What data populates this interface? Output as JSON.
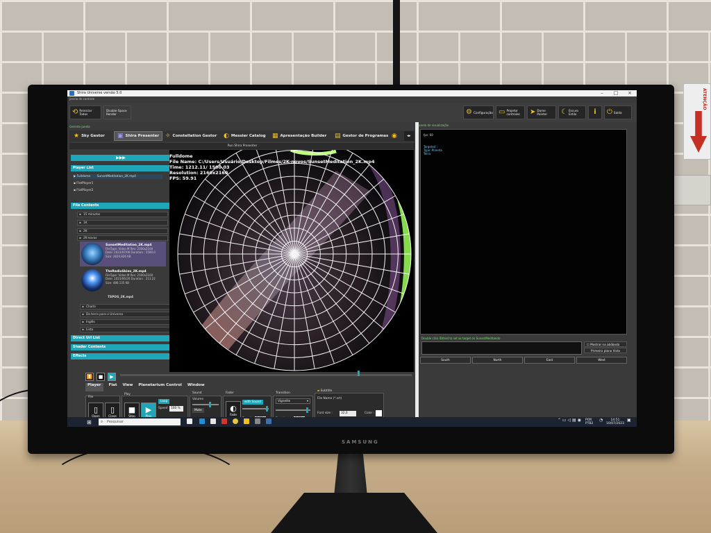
{
  "window": {
    "title": "Shira Universe versão 5.0",
    "control_label": "Janela de controle"
  },
  "toolbar": {
    "reiniciar": "Reiniciar Todos",
    "disable_space": "Disable Space Render",
    "configuracao": "Configuração",
    "projetor": "Projetor controles",
    "dome_pointer": "Dome Pointer",
    "escuro": "Escuro Estilo",
    "info": "i",
    "saida": "Saída"
  },
  "gerente_label": "Gerente Janela",
  "visualizacao_label": "Janela de visualização",
  "tabs": [
    {
      "label": "Sky Gestor"
    },
    {
      "label": "Shira Presenter"
    },
    {
      "label": "Constellation Gestor"
    },
    {
      "label": "Messier Catalog"
    },
    {
      "label": "Apresentação Builder"
    },
    {
      "label": "Gestor de Programas"
    }
  ],
  "run_bar": "Run Shira Presenter",
  "left": {
    "play_all": "▶▶▶",
    "player_list_title": "Player List",
    "players": [
      {
        "name": "Fulldome",
        "file": "SunsetMeditation_2K.mp4"
      },
      {
        "name": "FlatPlayer1",
        "file": ""
      },
      {
        "name": "FlatPlayer2",
        "file": ""
      }
    ],
    "file_contents_title": "File Contents",
    "folders": [
      "15 minutos",
      "1K",
      "2K",
      "2K-novos"
    ],
    "files": [
      {
        "name": "SunsetMeditation_2K.mp4",
        "info1": "FileType: Video M Res: 2160x2160",
        "info2": "Date: 2023/07/06 Duration : 1500.0",
        "info3": "Size: 2820.826 KB"
      },
      {
        "name": "TheRadioSkies_2K.mp4",
        "info1": "FileType: Video M Res: 2160x2160",
        "info2": "Date: 2023/06/26 Duration : 213.22",
        "info3": "Size: 486.135 KB"
      }
    ],
    "partial_file": "TSPOG_2K.mp4",
    "folders2": [
      "Charts",
      "Da terra para o Universo",
      "Inglês",
      "Lista"
    ],
    "direct_url": "Direct Url List",
    "shader_contents": "Shader Contents",
    "effects": "Effects"
  },
  "dome": {
    "title": "Fulldome",
    "file": "File Name: C:/Users/Usuário/Desktop/Filmes/2K-novos/SunsetMeditation_2K.mp4",
    "time": "Time: 1212.11/ 1500.03",
    "resolution": "Resolution: 2160x2160",
    "fps": "FPS: 59.91"
  },
  "right": {
    "fps": "fps: 60",
    "targeted": "Targeted :",
    "type": "Type: Planeta",
    "name": "Terra",
    "dblclick_hint": "Double click ID/text to set as target on SunsetMeditando",
    "mostrar": "Mostrar na abóboda",
    "primeiro": "Primeiro plano Vista",
    "directions": [
      "South",
      "North",
      "East",
      "West"
    ]
  },
  "bottom": {
    "subtabs": [
      "Player",
      "Flat",
      "View",
      "Planetarium Control",
      "Window"
    ],
    "file_section": "File",
    "play_section": "Play",
    "sound_section": "Sound",
    "fader_section": "Fader",
    "transition_section": "Transition",
    "subtitle_section": "Subtitle",
    "open": "Open",
    "close": "Close",
    "stop": "Stop",
    "play": "Play",
    "loop": "Loop",
    "speed_label": "Speed",
    "speed_value": "100 %",
    "volume": "Volume",
    "mute": "Mute",
    "fade": "Fade",
    "with_sound": "with Sound",
    "duration_label": "Duration",
    "fader_duration": "2,00",
    "transition_type": "Vignette",
    "transition_duration": "2,00",
    "subtitle_file": "File Name (*.srt)",
    "font_size_label": "Font size :",
    "font_size": "32,0",
    "color_label": "Color :"
  },
  "taskbar": {
    "search_placeholder": "Pesquisar",
    "lang": "POR",
    "lang2": "PTB2",
    "time": "14:51",
    "date": "10/07/2023"
  },
  "monitor": {
    "brand": "SAMSUNG"
  },
  "environment": {
    "sign_text": "ATENÇÃO"
  }
}
